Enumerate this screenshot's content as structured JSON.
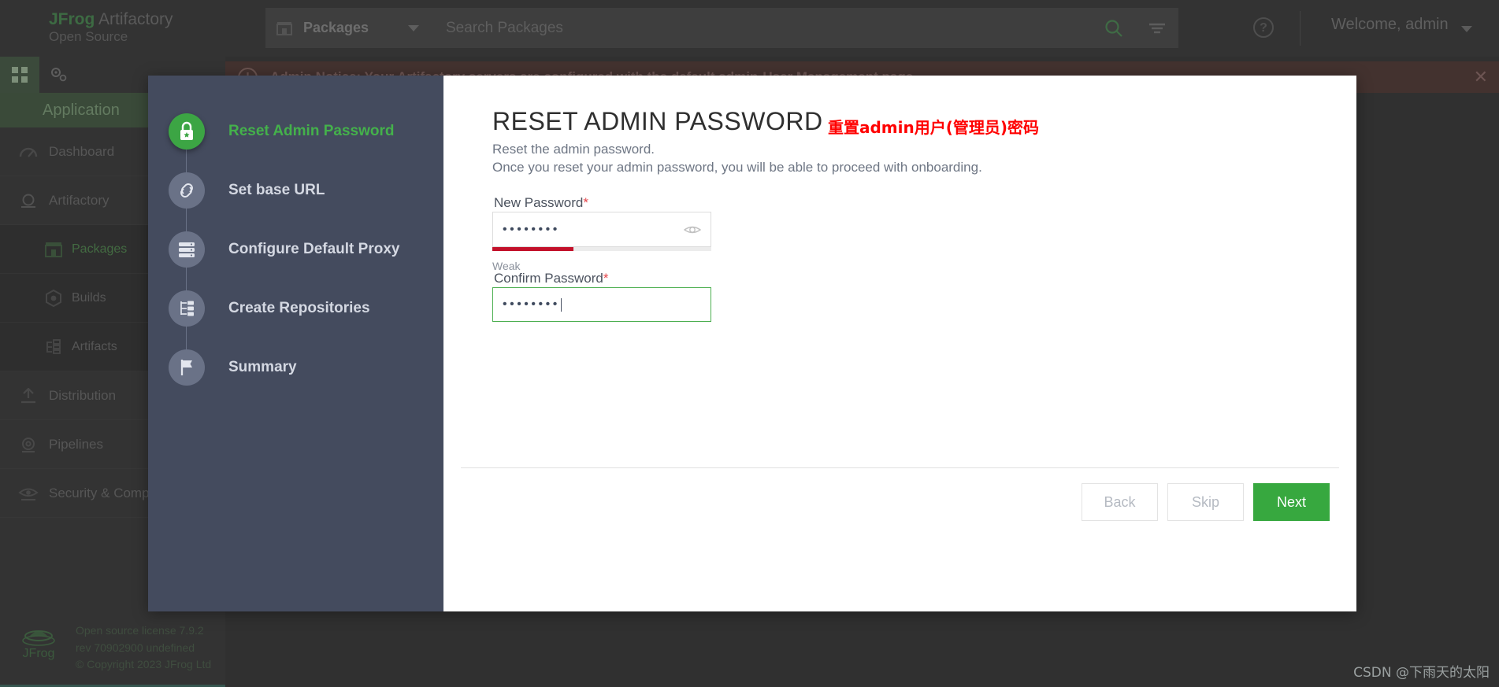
{
  "topbar": {
    "brand_primary": "JFrog",
    "brand_secondary": "Artifactory",
    "brand_edition": "Open Source",
    "package_selector_label": "Packages",
    "package_icon": "package-icon",
    "caret_icon": "chevron-down-icon",
    "search_placeholder": "Search Packages",
    "search_icon": "search-icon",
    "filter_icon": "filter-icon",
    "help_label": "?",
    "help_icon": "help-circle-icon",
    "welcome_label": "Welcome, admin",
    "welcome_caret_icon": "chevron-down-icon"
  },
  "notification": {
    "warning_icon": "warning-circle-icon",
    "text": "Admin Notice: Your Artifactory servers are configured with the default admin",
    "link_text": "User Management page.",
    "close_icon": "close-icon"
  },
  "leftnav": {
    "tab_apps_icon": "grid-apps-icon",
    "tab_admin_icon": "gears-icon",
    "section_title": "Application",
    "items": [
      {
        "label": "Dashboard",
        "icon": "dashboard-gauge-icon"
      },
      {
        "label": "Artifactory",
        "icon": "artifactory-icon"
      },
      {
        "label": "Distribution",
        "icon": "distribution-upload-icon"
      },
      {
        "label": "Pipelines",
        "icon": "pipelines-gear-icon"
      },
      {
        "label": "Security & Compliance",
        "icon": "eye-security-icon"
      }
    ],
    "sub_items": [
      {
        "label": "Packages",
        "icon": "packages-box-icon",
        "selected": true
      },
      {
        "label": "Builds",
        "icon": "builds-hex-icon",
        "selected": false
      },
      {
        "label": "Artifacts",
        "icon": "artifacts-tree-icon",
        "selected": false
      }
    ]
  },
  "footer": {
    "logo_icon": "jfrog-logo-icon",
    "line1": "Open source license 7.9.2 rev 70902900 undefined",
    "line2": "© Copyright 2023 JFrog Ltd"
  },
  "modal": {
    "steps": [
      {
        "label": "Reset Admin Password",
        "icon": "lock-icon",
        "active": true
      },
      {
        "label": "Set base URL",
        "icon": "link-icon",
        "active": false
      },
      {
        "label": "Configure Default Proxy",
        "icon": "server-icon",
        "active": false
      },
      {
        "label": "Create Repositories",
        "icon": "repository-tree-icon",
        "active": false
      },
      {
        "label": "Summary",
        "icon": "flag-icon",
        "active": false
      }
    ],
    "title": "RESET ADMIN PASSWORD",
    "annotation": "重置admin用户(管理员)密码",
    "subtitle_line1": "Reset the admin password.",
    "subtitle_line2": "Once you reset your admin password, you will be able to proceed with onboarding.",
    "new_password_label": "New Password",
    "required_mark": "*",
    "new_password_value": "••••••••",
    "toggle_visibility_icon": "eye-icon",
    "strength_percent": 37,
    "strength_text": "Weak",
    "strength_color": "#c3112b",
    "confirm_password_label": "Confirm Password",
    "confirm_password_value": "••••••••",
    "buttons": {
      "back": "Back",
      "skip": "Skip",
      "next": "Next"
    },
    "accent_green": "#37a83f",
    "sidebar_color": "#444b5e"
  },
  "watermark": {
    "text": "CSDN @下雨天的太阳"
  }
}
